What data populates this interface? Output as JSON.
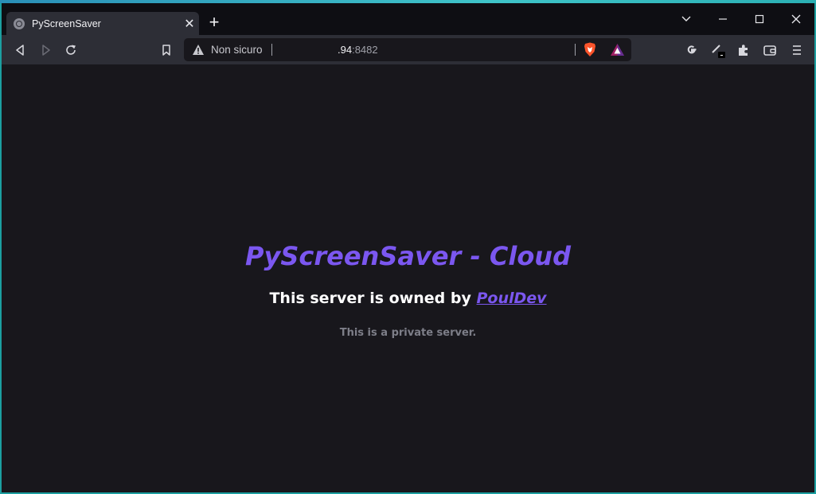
{
  "tab": {
    "title": "PyScreenSaver",
    "close_glyph": "✕",
    "favicon": "globe-icon"
  },
  "new_tab_glyph": "+",
  "address_bar": {
    "security_label": "Non sicuro",
    "url_host": ".94",
    "url_port": ":8482"
  },
  "page": {
    "heading": "PyScreenSaver - Cloud",
    "owner_prefix": "This server is owned by ",
    "owner_link": "PoulDev",
    "note": "This is a private server."
  },
  "colors": {
    "accent_purple": "#7b57f0",
    "background": "#18171c",
    "toolbar": "#2d2e36",
    "brave_orange": "#fb542b"
  }
}
